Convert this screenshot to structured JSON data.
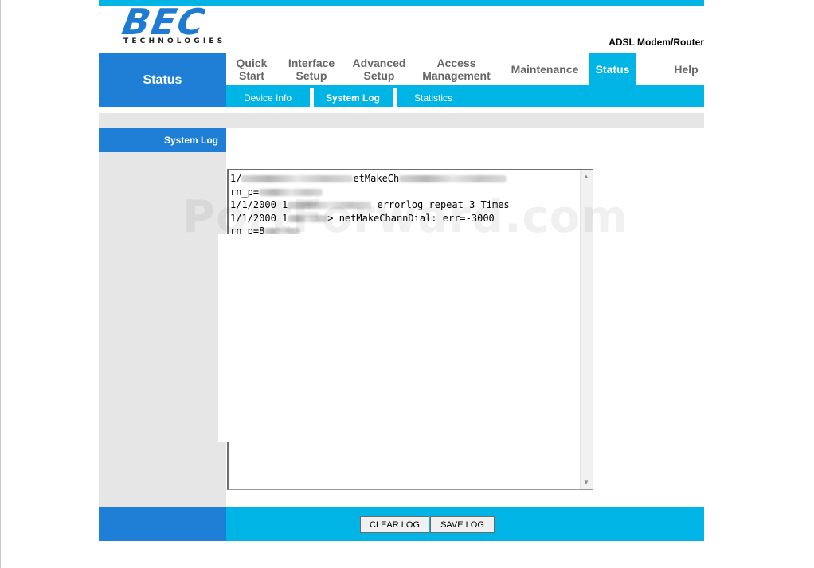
{
  "brand": {
    "logo_text": "BEC",
    "logo_subtext": "TECHNOLOGIES",
    "product": "ADSL Modem/Router"
  },
  "nav": {
    "section_title": "Status",
    "tabs": [
      {
        "line1": "Quick",
        "line2": "Start"
      },
      {
        "line1": "Interface",
        "line2": "Setup"
      },
      {
        "line1": "Advanced",
        "line2": "Setup"
      },
      {
        "line1": "Access",
        "line2": "Management"
      },
      {
        "line1": "Maintenance",
        "line2": ""
      },
      {
        "line1": "Status",
        "line2": ""
      },
      {
        "line1": "Help",
        "line2": ""
      }
    ],
    "active_tab": "Status",
    "subtabs": [
      "Device Info",
      "System Log",
      "Statistics"
    ],
    "active_subtab": "System Log"
  },
  "page": {
    "section_label": "System Log"
  },
  "log": {
    "lines": [
      {
        "start": "1/",
        "end": "etMakeCh"
      },
      {
        "start": "rn_p=",
        "end": ""
      },
      {
        "start": "1/1/2000 1",
        "end": " errorlog repeat 3 Times"
      },
      {
        "start": "1/1/2000 1",
        "end": "> netMakeChannDial: err=-3000"
      },
      {
        "start": "rn_p=8",
        "end": ""
      }
    ]
  },
  "buttons": {
    "clear": "CLEAR LOG",
    "save": "SAVE LOG"
  },
  "watermark": "PortForward.com",
  "colors": {
    "accent_cyan": "#00b4e6",
    "accent_blue": "#1f7fd6",
    "panel_gray": "#e6e6e6",
    "logo_blue": "#1f7bd1"
  }
}
